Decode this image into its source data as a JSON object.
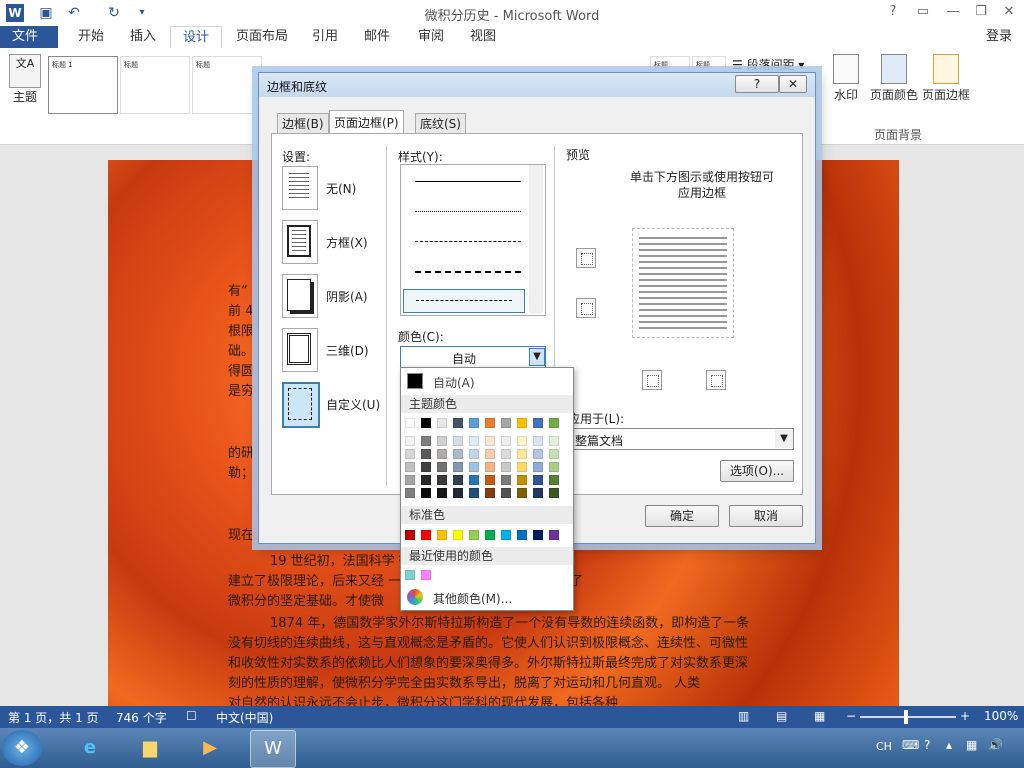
{
  "window": {
    "title": "微积分历史 - Microsoft Word",
    "controls": [
      "?",
      "▭",
      "—",
      "❐",
      "✕"
    ]
  },
  "ribbon": {
    "login": "登录",
    "tabs": [
      "文件",
      "开始",
      "插入",
      "设计",
      "页面布局",
      "引用",
      "邮件",
      "审阅",
      "视图"
    ],
    "active_tab": "设计",
    "theme_label": "主题",
    "style_thumbs": [
      "标题 1",
      "标题",
      "标题",
      "标题",
      "标题"
    ],
    "paragraph_spacing": "段落间距",
    "watermark": "水印",
    "page_color": "页面颜色",
    "page_border": "页面边框",
    "group_page_background": "页面背景"
  },
  "document": {
    "lines": [
      "有“",
      "前 4",
      "根限",
      "础。",
      "得圆",
      "是穷",
      "的研",
      "勒；",
      "现在",
      "19 世纪初，法国科学                       微积分的理论进行了认真研究，",
      "建立了极限理论，后来又经                      一步的严格化，使极限理论成为了",
      "微积分的坚定基础。才使微",
      "1874 年，德国数学家外尔斯特拉斯构造了一个没有导数的连续函数，即构造了一条",
      "没有切线的连续曲线，这与直观概念是矛盾的。它使人们认识到极限概念、连续性、可微性",
      "和收敛性对实数系的依赖比人们想象的要深奥得多。外尔斯特拉斯最终完成了对实数系更深",
      "刻的性质的理解，使微积分学完全由实数系导出，脱离了对运动和几何直观。    人类",
      "对自然的认识永远不会止步，微积分这门学科的现代发展，包括各种"
    ]
  },
  "dialog": {
    "title": "边框和底纹",
    "help": "?",
    "close": "✕",
    "tabs": [
      "边框(B)",
      "页面边框(P)",
      "底纹(S)"
    ],
    "active_tab": "页面边框(P)",
    "settings_label": "设置:",
    "settings": [
      "无(N)",
      "方框(X)",
      "阴影(A)",
      "三维(D)",
      "自定义(U)"
    ],
    "selected_setting": "自定义(U)",
    "style_label": "样式(Y):",
    "color_label": "颜色(C):",
    "color_value": "自动",
    "preview_label": "预览",
    "preview_hint_1": "单击下方图示或使用按钮可",
    "preview_hint_2": "应用边框",
    "apply_to_label": "应用于(L):",
    "apply_to_value": "整篇文档",
    "options": "选项(O)...",
    "ok": "确定",
    "cancel": "取消"
  },
  "color_dropdown": {
    "auto": "自动(A)",
    "theme_header": "主题颜色",
    "standard_header": "标准色",
    "recent_header": "最近使用的颜色",
    "more": "其他颜色(M)...",
    "theme_top": [
      "#ffffff",
      "#000000",
      "#e7e6e6",
      "#44546a",
      "#5b9bd5",
      "#ed7d31",
      "#a5a5a5",
      "#ffc000",
      "#4472c4",
      "#70ad47"
    ],
    "theme_shades": [
      [
        "#f2f2f2",
        "#7f7f7f",
        "#d0cece",
        "#d6dce4",
        "#deebf6",
        "#fbe5d5",
        "#ededed",
        "#fff2cc",
        "#dae3f3",
        "#e2efd9"
      ],
      [
        "#d8d8d8",
        "#595959",
        "#aeabab",
        "#adb9ca",
        "#bdd7ee",
        "#f7cbac",
        "#dbdbdb",
        "#fee599",
        "#b4c6e7",
        "#c5e0b3"
      ],
      [
        "#bfbfbf",
        "#3f3f3f",
        "#757070",
        "#8496b0",
        "#9cc3e5",
        "#f4b183",
        "#c9c9c9",
        "#ffd965",
        "#8eaadb",
        "#a8d08d"
      ],
      [
        "#a5a5a5",
        "#262626",
        "#3a3838",
        "#323f4f",
        "#2e75b5",
        "#c55a11",
        "#7b7b7b",
        "#bf9000",
        "#2f5496",
        "#538135"
      ],
      [
        "#7f7f7f",
        "#0c0c0c",
        "#171616",
        "#222a35",
        "#1e4e79",
        "#833c0b",
        "#525252",
        "#7f6000",
        "#1f3864",
        "#375623"
      ]
    ],
    "standard": [
      "#c00000",
      "#ff0000",
      "#ffc000",
      "#ffff00",
      "#92d050",
      "#00b050",
      "#00b0f0",
      "#0070c0",
      "#002060",
      "#7030a0"
    ],
    "recent": [
      "#7fd1d1",
      "#ff80ff"
    ]
  },
  "status_bar": {
    "page": "第 1 页，共 1 页",
    "words": "746 个字",
    "language": "中文(中国)",
    "zoom": "100%"
  },
  "taskbar": {
    "clock_lang": "CH"
  }
}
